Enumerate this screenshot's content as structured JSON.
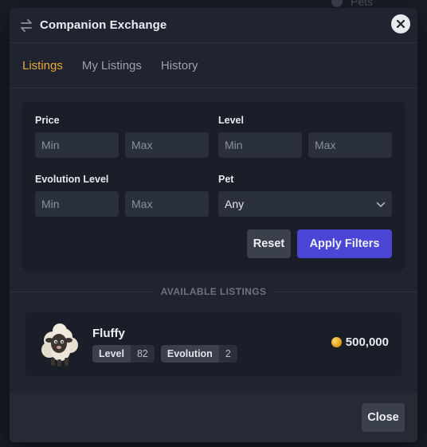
{
  "background": {
    "hint_text": "Pets"
  },
  "modal": {
    "title": "Companion Exchange"
  },
  "tabs": [
    {
      "label": "Listings",
      "active": true
    },
    {
      "label": "My Listings",
      "active": false
    },
    {
      "label": "History",
      "active": false
    }
  ],
  "filters": {
    "price": {
      "label": "Price",
      "min_placeholder": "Min",
      "max_placeholder": "Max"
    },
    "level": {
      "label": "Level",
      "min_placeholder": "Min",
      "max_placeholder": "Max"
    },
    "evolution": {
      "label": "Evolution Level",
      "min_placeholder": "Min",
      "max_placeholder": "Max"
    },
    "pet": {
      "label": "Pet",
      "selected": "Any"
    },
    "reset_label": "Reset",
    "apply_label": "Apply Filters"
  },
  "section_title": "AVAILABLE LISTINGS",
  "listings": [
    {
      "name": "Fluffy",
      "level_label": "Level",
      "level": "82",
      "evolution_label": "Evolution",
      "evolution": "2",
      "price": "500,000"
    }
  ],
  "footer": {
    "close_label": "Close"
  },
  "colors": {
    "accent_tab": "#e8a938",
    "primary_button": "#4b46d6",
    "modal_bg": "#1f2430"
  }
}
